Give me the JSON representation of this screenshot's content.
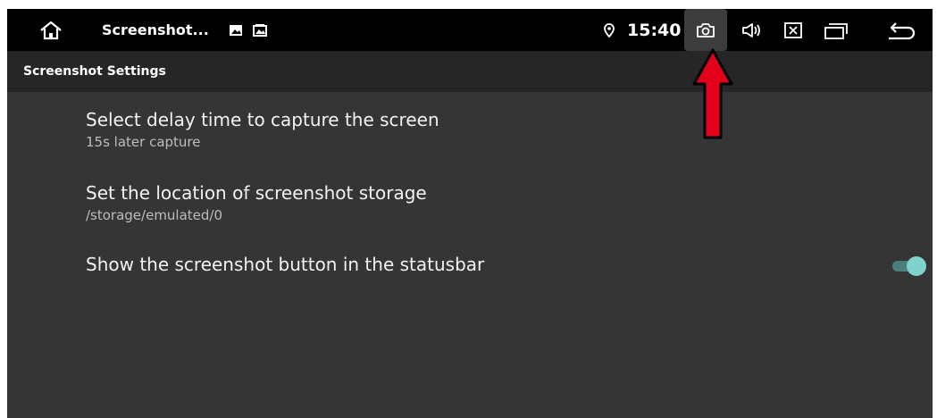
{
  "statusbar": {
    "app_title": "Screenshot...",
    "time": "15:40",
    "icons": [
      "home-icon",
      "image-icon",
      "gallery-icon",
      "location-icon",
      "camera-icon",
      "volume-icon",
      "close-box-icon",
      "recents-icon",
      "back-icon"
    ]
  },
  "header": {
    "title": "Screenshot Settings"
  },
  "preferences": [
    {
      "title": "Select delay time to capture the screen",
      "summary": "15s later capture"
    },
    {
      "title": "Set the location of screenshot storage",
      "summary": "/storage/emulated/0"
    },
    {
      "title": "Show the screenshot button in the statusbar",
      "toggle_on": true
    }
  ],
  "colors": {
    "statusbar_bg": "#000000",
    "subheader_bg": "#262626",
    "content_bg": "#353535",
    "toggle_thumb": "#7fd3cc",
    "toggle_track": "#4a7f7c",
    "annotation_arrow": "#e3001b"
  }
}
